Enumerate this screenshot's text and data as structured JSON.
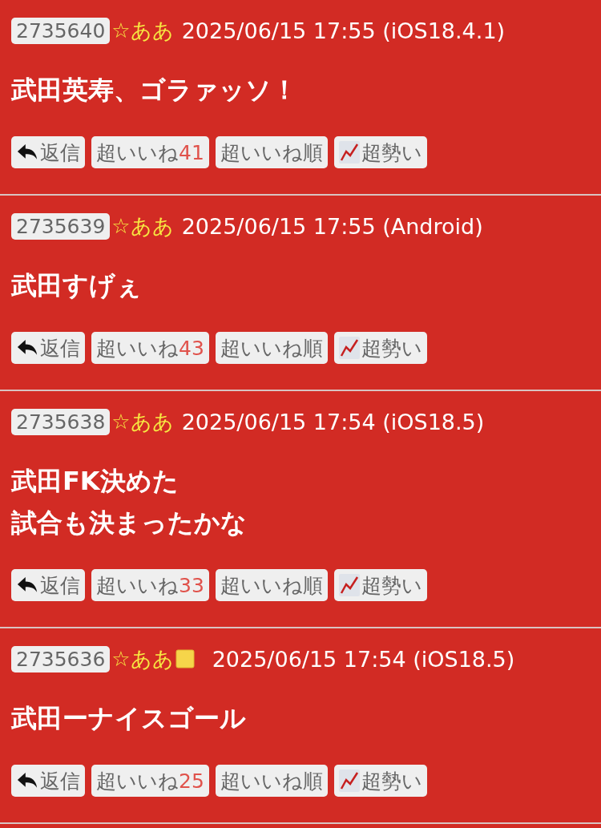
{
  "posts": [
    {
      "number": "2735640",
      "name": "☆ああ",
      "square": false,
      "meta": "2025/06/15 17:55 (iOS18.4.1)",
      "body": [
        "武田英寿、ゴラァッソ！"
      ],
      "reply": "返信",
      "like_label": "超いいね",
      "like_count": "41",
      "sort": "超いいね順",
      "trend": "超勢い"
    },
    {
      "number": "2735639",
      "name": "☆ああ",
      "square": false,
      "meta": "2025/06/15 17:55 (Android)",
      "body": [
        "武田すげぇ"
      ],
      "reply": "返信",
      "like_label": "超いいね",
      "like_count": "43",
      "sort": "超いいね順",
      "trend": "超勢い"
    },
    {
      "number": "2735638",
      "name": "☆ああ",
      "square": false,
      "meta": "2025/06/15 17:54 (iOS18.5)",
      "body": [
        "武田FK決めた",
        "試合も決まったかな"
      ],
      "reply": "返信",
      "like_label": "超いいね",
      "like_count": "33",
      "sort": "超いいね順",
      "trend": "超勢い"
    },
    {
      "number": "2735636",
      "name": "☆ああ",
      "square": true,
      "meta": "2025/06/15 17:54 (iOS18.5)",
      "body": [
        "武田ーナイスゴール"
      ],
      "reply": "返信",
      "like_label": "超いいね",
      "like_count": "25",
      "sort": "超いいね順",
      "trend": "超勢い"
    }
  ]
}
